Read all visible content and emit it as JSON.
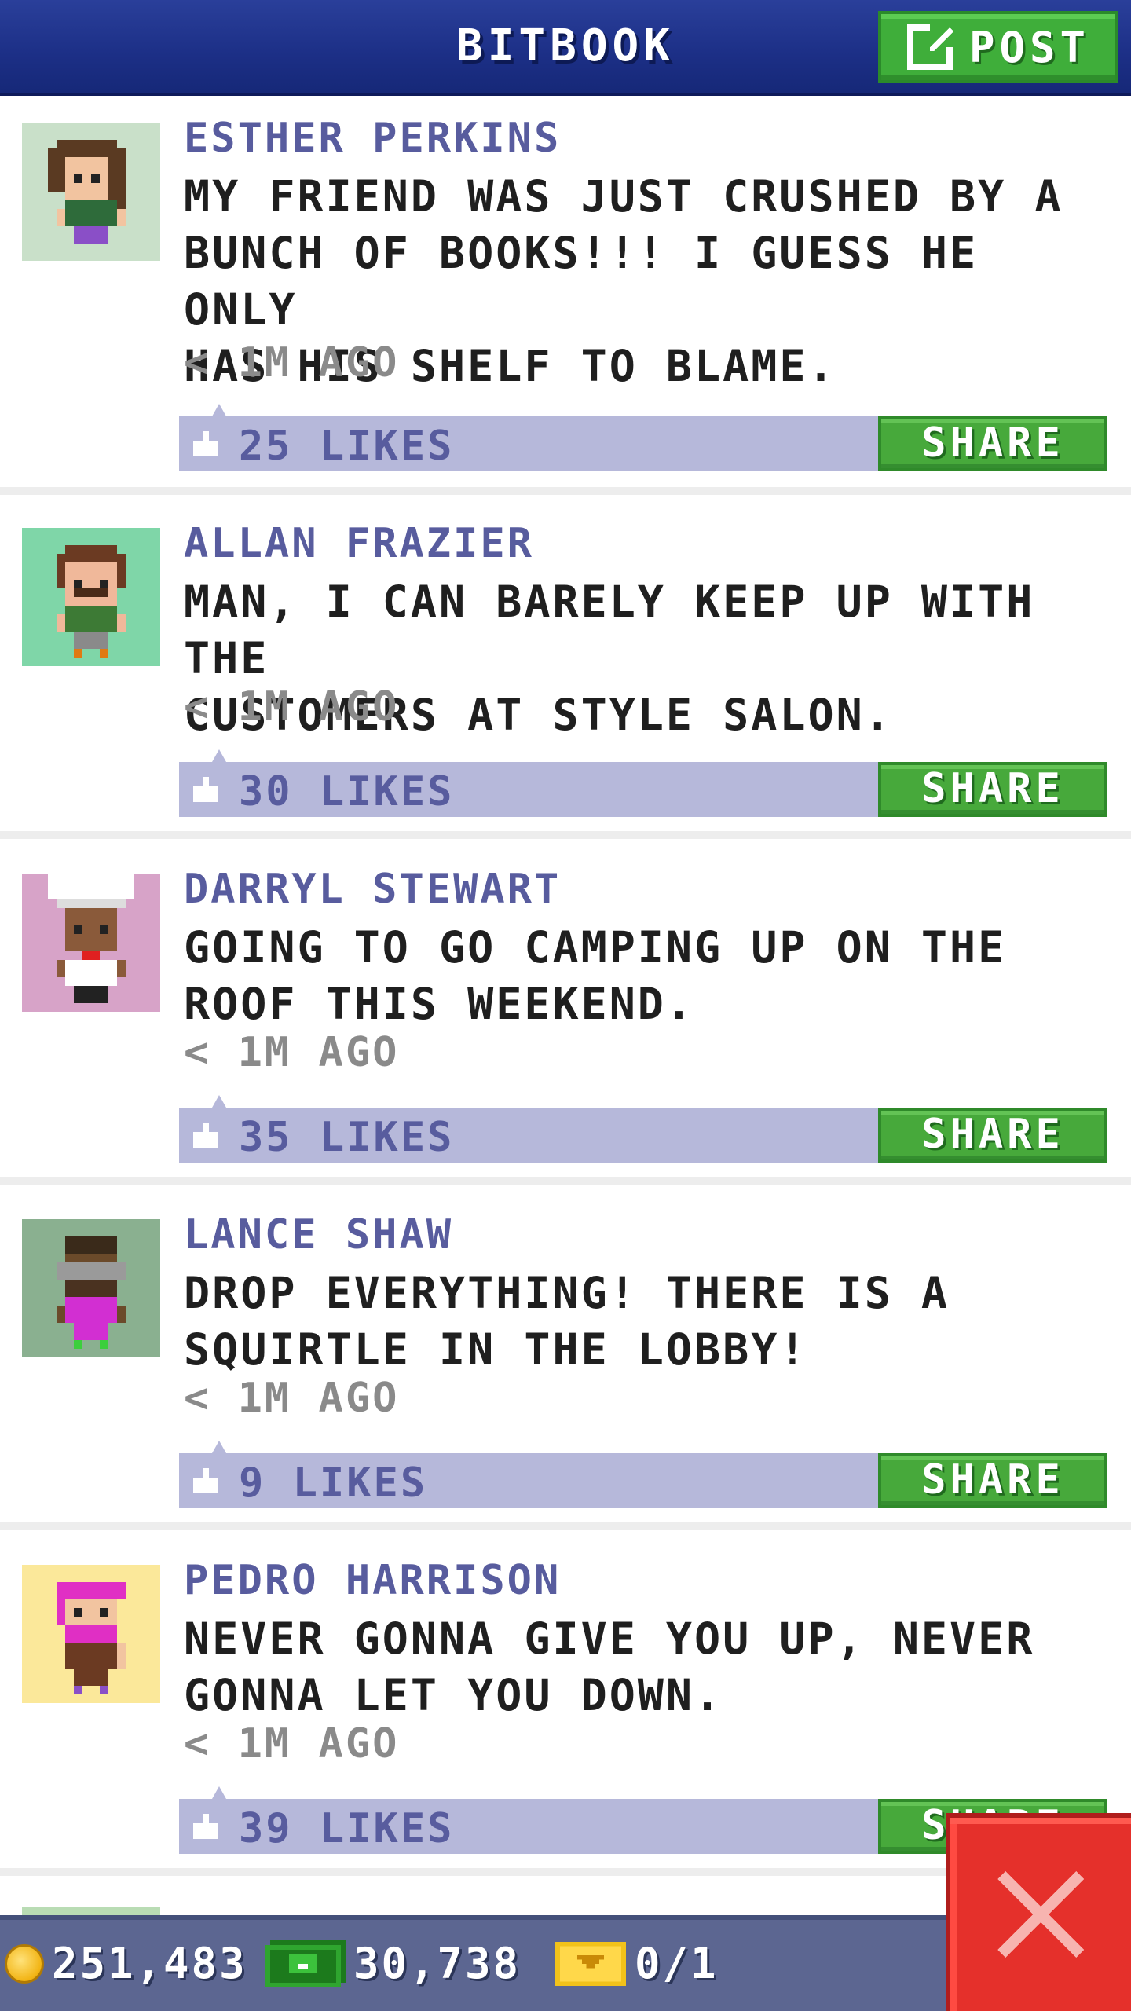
{
  "header": {
    "title": "BITBOOK",
    "post_label": "POST"
  },
  "posts": [
    {
      "name": "ESTHER PERKINS",
      "message": "MY FRIEND WAS JUST CRUSHED BY A\nBUNCH OF BOOKS!!! I GUESS HE ONLY\nHAS HIS SHELF TO BLAME.",
      "time": "< 1M AGO",
      "likes": "25 LIKES",
      "share": "SHARE",
      "avatar_bg": "#c9e0c9",
      "hair": "#5a3a22",
      "shirt": "#2e6b3a"
    },
    {
      "name": "ALLAN FRAZIER",
      "message": "MAN, I CAN BARELY KEEP UP WITH THE\nCUSTOMERS AT STYLE SALON.",
      "time": "< 1M AGO",
      "likes": "30 LIKES",
      "share": "SHARE",
      "avatar_bg": "#7fd6a8",
      "hair": "#6b3a22",
      "shirt": "#3d7a35"
    },
    {
      "name": "DARRYL STEWART",
      "message": "GOING TO GO CAMPING UP ON THE\nROOF THIS WEEKEND.",
      "time": "< 1M AGO",
      "likes": "35 LIKES",
      "share": "SHARE",
      "avatar_bg": "#d7a3c8",
      "hair": "#ffffff",
      "shirt": "#ffffff"
    },
    {
      "name": "LANCE SHAW",
      "message": "DROP EVERYTHING! THERE IS A\nSQUIRTLE IN THE LOBBY!",
      "time": "< 1M AGO",
      "likes": "9 LIKES",
      "share": "SHARE",
      "avatar_bg": "#8ab090",
      "hair": "#7a7a7a",
      "shirt": "#d22fd2"
    },
    {
      "name": "PEDRO HARRISON",
      "message": "NEVER GONNA GIVE YOU UP, NEVER\nGONNA LET YOU DOWN.",
      "time": "< 1M AGO",
      "likes": "39 LIKES",
      "share": "SHARE",
      "avatar_bg": "#fbe89a",
      "hair": "#e02fc4",
      "shirt": "#6b3a22"
    }
  ],
  "footer": {
    "coins": "251,483",
    "bux": "30,738",
    "tickets": "0/1"
  },
  "colors": {
    "header": "#1c2f86",
    "accent_green": "#47a93b",
    "likes_bar": "#b6b8da",
    "name_text": "#585c9e",
    "bottom_bar": "#5c6691",
    "close_red": "#e5302b"
  },
  "icons": [
    "edit-icon",
    "thumbs-up-icon",
    "coin-icon",
    "bux-icon",
    "ticket-icon",
    "close-icon"
  ]
}
